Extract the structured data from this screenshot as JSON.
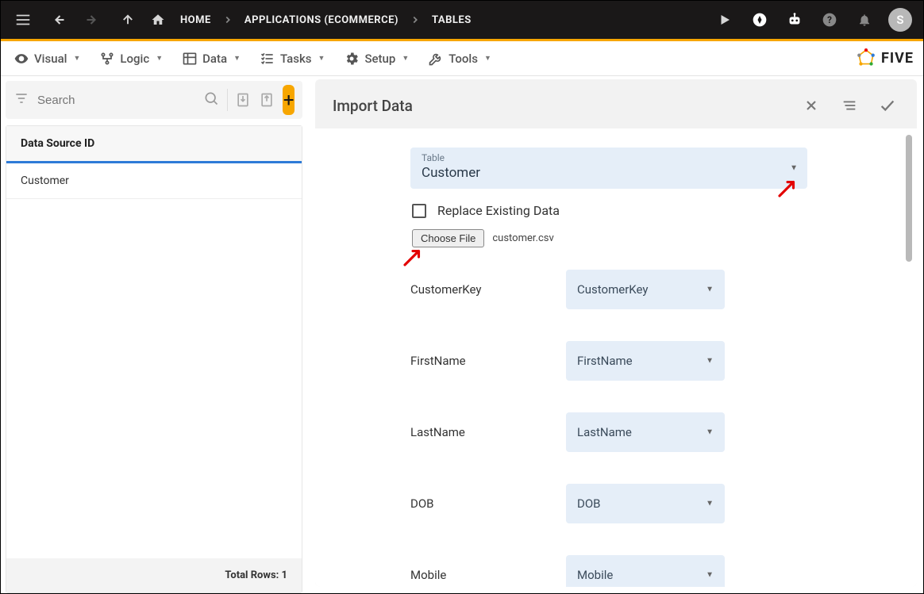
{
  "topbar": {
    "breadcrumbs": [
      "HOME",
      "APPLICATIONS (ECOMMERCE)",
      "TABLES"
    ],
    "avatar_initial": "S"
  },
  "tabs": {
    "visual": "Visual",
    "logic": "Logic",
    "data": "Data",
    "tasks": "Tasks",
    "setup": "Setup",
    "tools": "Tools",
    "brand": "FIVE"
  },
  "sidebar": {
    "search_placeholder": "Search",
    "list_header": "Data Source ID",
    "rows": [
      "Customer"
    ],
    "footer_label": "Total Rows:",
    "footer_value": "1"
  },
  "panel": {
    "title": "Import Data",
    "table_label": "Table",
    "table_value": "Customer",
    "replace_label": "Replace Existing Data",
    "choose_file_label": "Choose File",
    "filename": "customer.csv",
    "mappings": [
      {
        "label": "CustomerKey",
        "value": "CustomerKey"
      },
      {
        "label": "FirstName",
        "value": "FirstName"
      },
      {
        "label": "LastName",
        "value": "LastName"
      },
      {
        "label": "DOB",
        "value": "DOB"
      },
      {
        "label": "Mobile",
        "value": "Mobile"
      }
    ]
  }
}
